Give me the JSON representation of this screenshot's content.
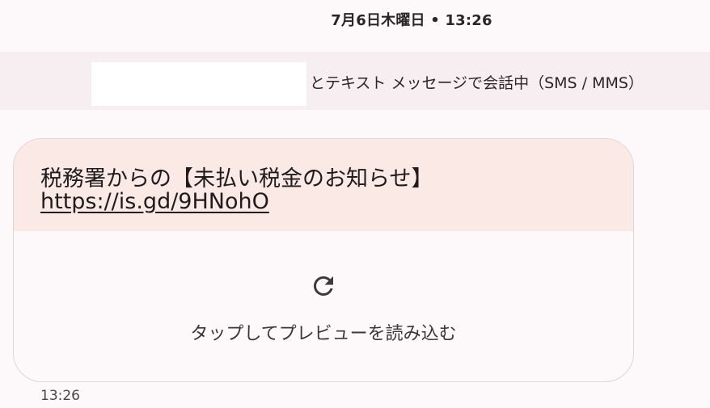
{
  "header": {
    "date": "7月6日木曜日 • 13:26"
  },
  "conversation": {
    "banner_text": "とテキスト メッセージで会話中（SMS / MMS）"
  },
  "message": {
    "text": "税務署からの【未払い税金のお知らせ】",
    "link": "https://is.gd/9HNohO",
    "preview_label": "タップしてプレビューを読み込む",
    "timestamp": "13:26",
    "preview_icon": "refresh-icon"
  },
  "colors": {
    "background": "#fdf8fa",
    "banner": "#f7eef1",
    "bubble_top": "#fbe9e6",
    "bubble_border": "#ddd6d9"
  }
}
